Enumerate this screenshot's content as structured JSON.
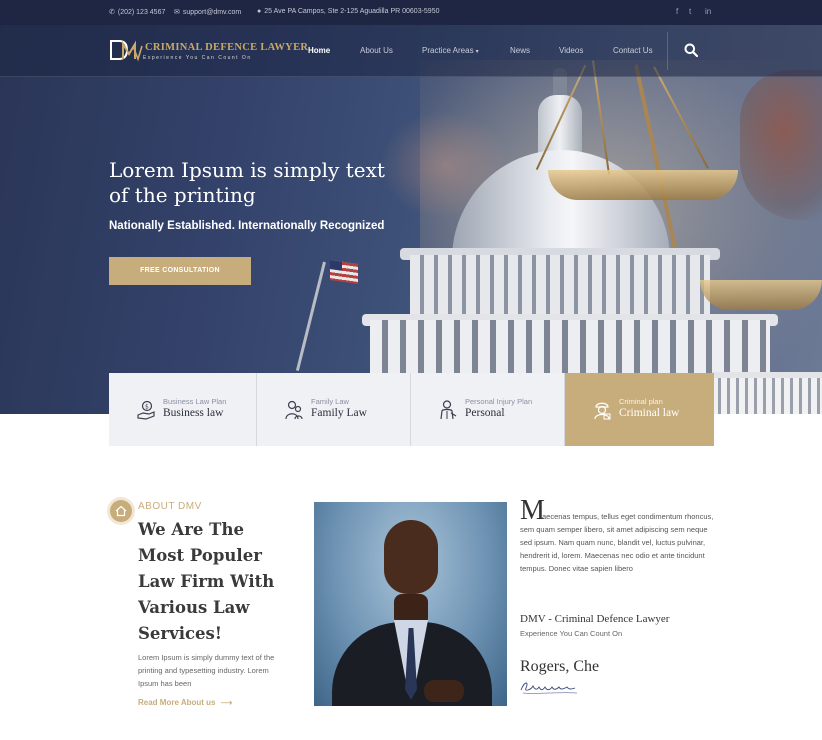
{
  "topbar": {
    "phone": "(202) 123 4567",
    "email": "support@dmv.com",
    "address": "25 Ave PA Campos, Ste 2-125 Aguadilla PR 00603-5950",
    "social": [
      "f",
      "t",
      "in"
    ]
  },
  "brand": {
    "logo_mark": "DMV",
    "title": "CRIMINAL DEFENCE LAWYER",
    "tagline": "Experience You Can Count On"
  },
  "nav": {
    "items": [
      "Home",
      "About Us",
      "Practice Areas",
      "News",
      "Videos",
      "Contact Us"
    ],
    "active": "Home",
    "dropdown_icon": "chevron-down-icon",
    "search_icon": "search-icon"
  },
  "hero": {
    "title": "Lorem Ipsum is simply text of the printing",
    "subtitle": "Nationally Established. Internationally Recognized",
    "cta": "FREE CONSULTATION"
  },
  "practice_cards": [
    {
      "small": "Business Law Plan",
      "title": "Business law",
      "icon": "money-hand-icon"
    },
    {
      "small": "Family Law",
      "title": "Family Law",
      "icon": "family-icon"
    },
    {
      "small": "Personal Injury Plan",
      "title": "Personal",
      "icon": "injury-icon"
    },
    {
      "small": "Criminal plan",
      "title": "Criminal law",
      "icon": "criminal-icon"
    }
  ],
  "about": {
    "label": "ABOUT DMV",
    "heading": "We Are The Most Populer Law Firm With Various Law Services!",
    "text": "Lorem Ipsum is simply dummy text of the printing and typesetting industry. Lorem Ipsum has been",
    "read_more": "Read More About us"
  },
  "bio": {
    "drop_cap": "M",
    "text": "aecenas tempus, tellus eget condimentum rhoncus, sem quam semper libero, sit amet adipiscing sem neque sed ipsum. Nam quam nunc, blandit vel, luctus pulvinar, hendrerit id, lorem. Maecenas nec odio et ante tincidunt tempus. Donec vitae sapien libero",
    "firm_name": "DMV - Criminal Defence Lawyer",
    "firm_tagline": "Experience You Can Count On",
    "person_name": "Rogers, Che"
  },
  "colors": {
    "accent": "#c8ad7c",
    "navy": "#1f2643"
  }
}
